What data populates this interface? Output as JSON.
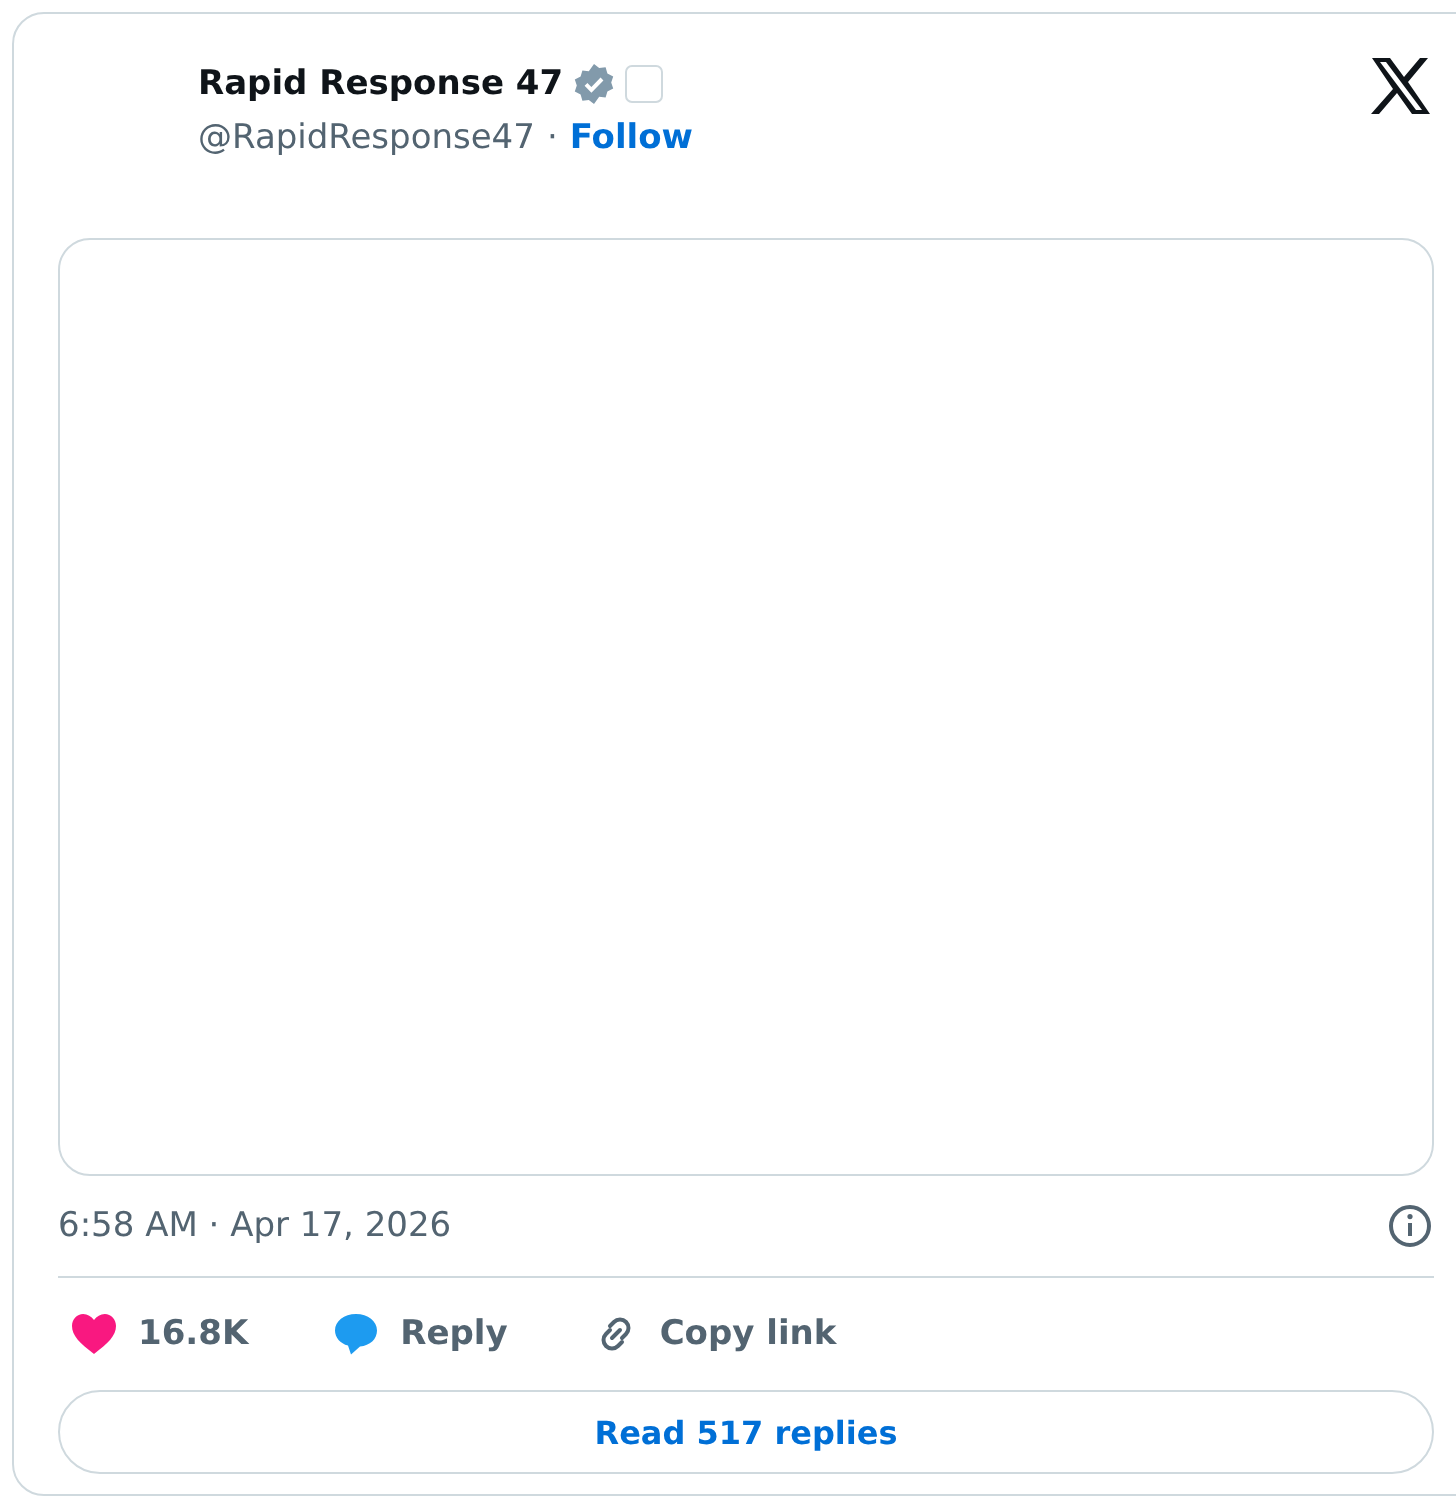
{
  "author": {
    "name": "Rapid Response 47",
    "verified": true,
    "handle": "@RapidResponse47",
    "separator": "·",
    "follow": "Follow"
  },
  "timestamp": "6:58 AM · Apr 17, 2026",
  "actions": [
    {
      "kind": "like",
      "label": "16.8K"
    },
    {
      "kind": "reply",
      "label": "Reply"
    },
    {
      "kind": "copy",
      "label": "Copy link"
    }
  ],
  "read_replies": "Read 517 replies"
}
